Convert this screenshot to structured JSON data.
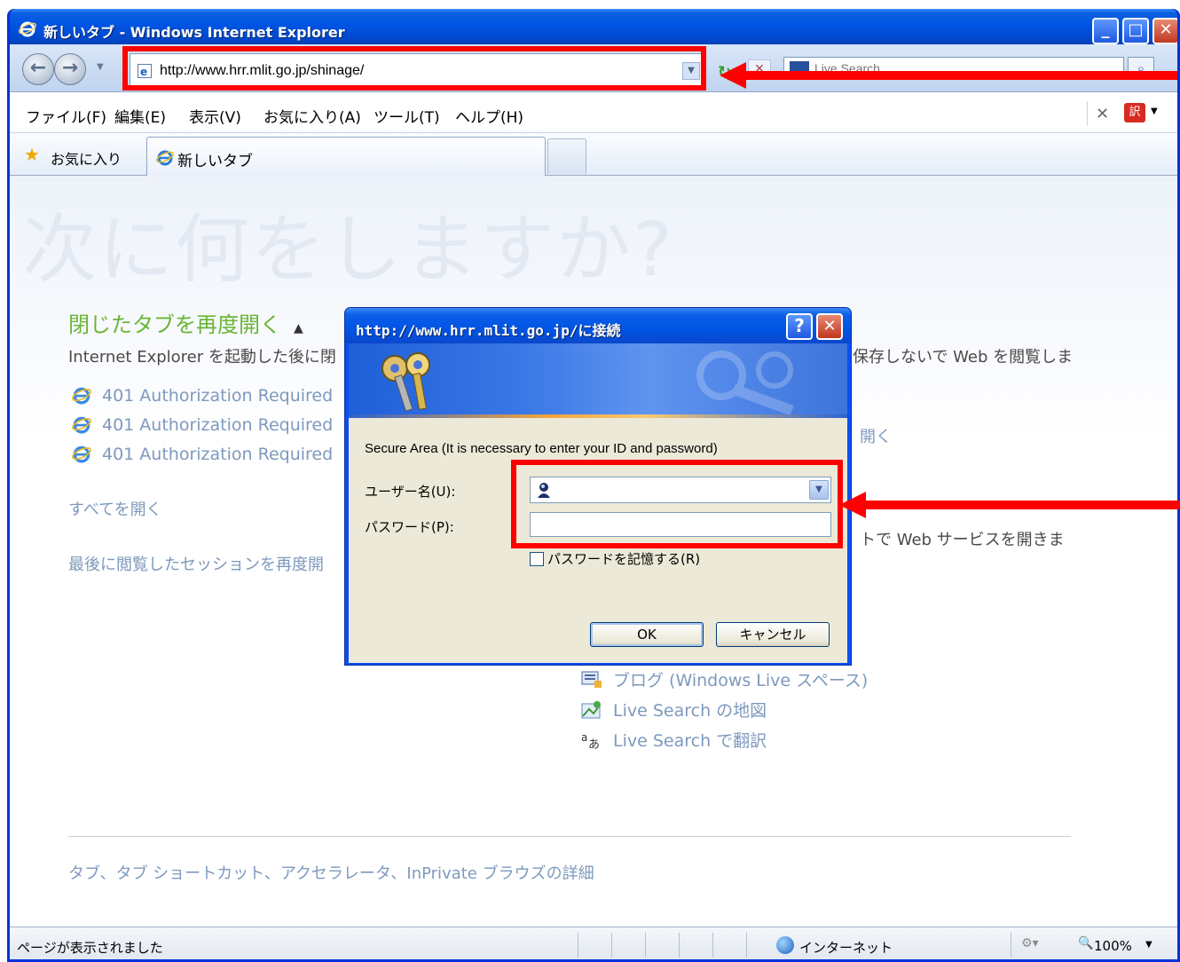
{
  "window": {
    "title": "新しいタブ - Windows Internet Explorer"
  },
  "nav": {
    "address": "http://www.hrr.mlit.go.jp/shinage/",
    "search_placeholder": "Live Search"
  },
  "menu": [
    "ファイル(F)",
    "編集(E)",
    "表示(V)",
    "お気に入り(A)",
    "ツール(T)",
    "ヘルプ(H)"
  ],
  "favorites": {
    "label": "お気に入り",
    "tab_label": "新しいタブ"
  },
  "page": {
    "hero": "次に何をしますか?",
    "reopen_title": "閉じたタブを再度開く",
    "reopen_desc": "Internet Explorer を起動した後に閉",
    "closed_tabs": [
      "401 Authorization Required",
      "401 Authorization Required",
      "401 Authorization Required"
    ],
    "open_all": "すべてを開く",
    "reopen_session": "最後に閲覧したセッションを再度開",
    "right_desc": "保存しないで Web を閲覧しま",
    "right_open": "開く",
    "right_services": "トで Web サービスを開きま",
    "services": [
      "ブログ (Windows Live スペース)",
      "Live Search の地図",
      "Live Search で翻訳"
    ],
    "footer": "タブ、タブ ショートカット、アクセラレータ、InPrivate ブラウズの詳細"
  },
  "status": {
    "text": "ページが表示されました",
    "zone": "インターネット",
    "zoom": "100%"
  },
  "dialog": {
    "title": "http://www.hrr.mlit.go.jp/に接続",
    "message": "Secure Area (It is necessary to enter your ID and password)",
    "user_label": "ユーザー名(U):",
    "pass_label": "パスワード(P):",
    "remember": "パスワードを記憶する(R)",
    "ok": "OK",
    "cancel": "キャンセル"
  },
  "colors": {
    "highlight": "#ff0000",
    "link": "#7d99bd",
    "section_title": "#69b637"
  }
}
